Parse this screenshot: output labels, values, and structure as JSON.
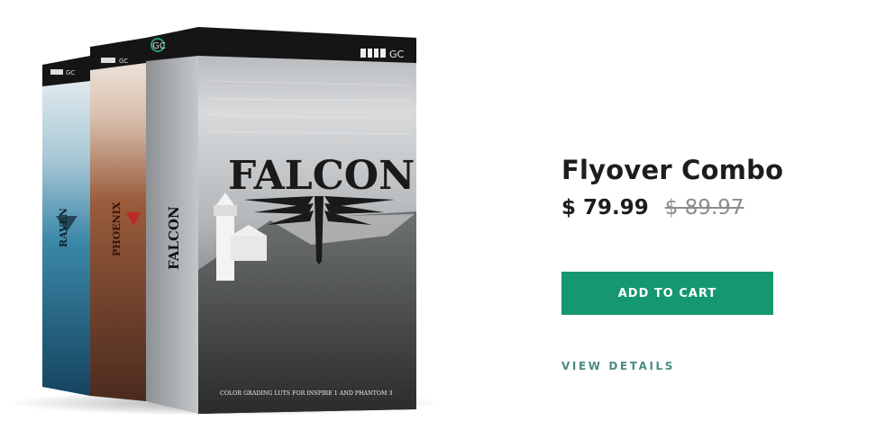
{
  "product": {
    "title": "Flyover Combo",
    "price": "$ 79.99",
    "original_price": "$ 89.97",
    "add_to_cart_label": "ADD TO CART",
    "view_details_label": "VIEW DETAILS"
  },
  "boxes": {
    "logo": "GC",
    "raven": "RAVEN",
    "phoenix": "PHOENIX",
    "falcon": "FALCON",
    "falcon_spine": "FALCON",
    "falcon_tagline": "COLOR GRADING LUTS FOR INSPIRE 1 AND PHANTOM 3"
  },
  "colors": {
    "accent_button": "#15976f",
    "link": "#4c8b82",
    "text": "#1d1d1d",
    "strike_price": "#8c8c8c"
  }
}
